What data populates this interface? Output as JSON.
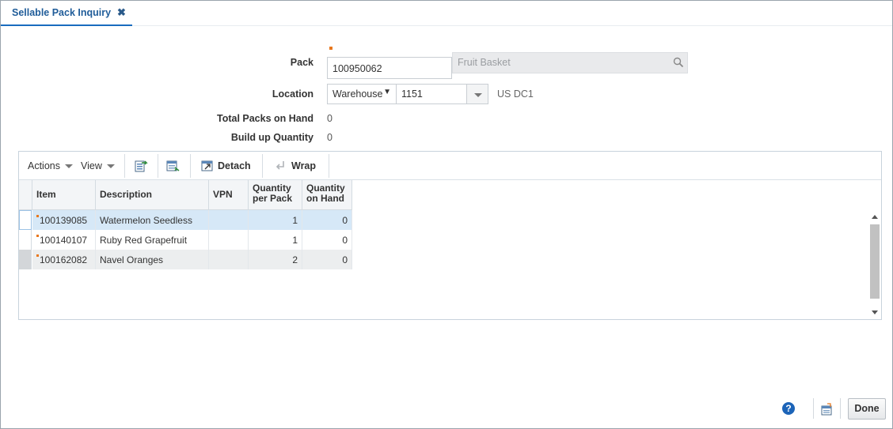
{
  "tab": {
    "title": "Sellable Pack Inquiry",
    "close_glyph": "✖"
  },
  "form": {
    "pack_label": "Pack",
    "pack_value": "100950062",
    "pack_description": "Fruit Basket",
    "location_label": "Location",
    "location_type": "Warehouse",
    "location_value": "1151",
    "location_name": "US DC1",
    "total_packs_label": "Total Packs on Hand",
    "total_packs_value": "0",
    "buildup_label": "Build up Quantity",
    "buildup_value": "0"
  },
  "toolbar": {
    "actions_label": "Actions",
    "view_label": "View",
    "detach_label": "Detach",
    "wrap_label": "Wrap"
  },
  "table": {
    "columns": [
      {
        "label": "Item"
      },
      {
        "label": "Description"
      },
      {
        "label": "VPN"
      },
      {
        "label": "Quantity\nper Pack",
        "line1": "Quantity",
        "line2": "per Pack"
      },
      {
        "label": "Quantity\non Hand",
        "line1": "Quantity",
        "line2": "on Hand"
      }
    ],
    "rows": [
      {
        "item": "100139085",
        "description": "Watermelon Seedless",
        "vpn": "",
        "qty_per_pack": "1",
        "qty_on_hand": "0",
        "state": "selected"
      },
      {
        "item": "100140107",
        "description": "Ruby Red Grapefruit",
        "vpn": "",
        "qty_per_pack": "1",
        "qty_on_hand": "0",
        "state": "normal"
      },
      {
        "item": "100162082",
        "description": "Navel Oranges",
        "vpn": "",
        "qty_per_pack": "2",
        "qty_on_hand": "0",
        "state": "alternate"
      }
    ]
  },
  "footer": {
    "help_glyph": "?",
    "done_label": "Done"
  },
  "colors": {
    "accent": "#1a6cbf",
    "required_marker": "#e8781e",
    "selected_row": "#d6e8f7",
    "alternate_row": "#eceeef"
  },
  "icons": [
    "close-icon",
    "search-icon",
    "dropdown-arrow-icon",
    "export-icon",
    "freeze-icon",
    "detach-icon",
    "wrap-icon",
    "help-icon",
    "report-icon"
  ]
}
